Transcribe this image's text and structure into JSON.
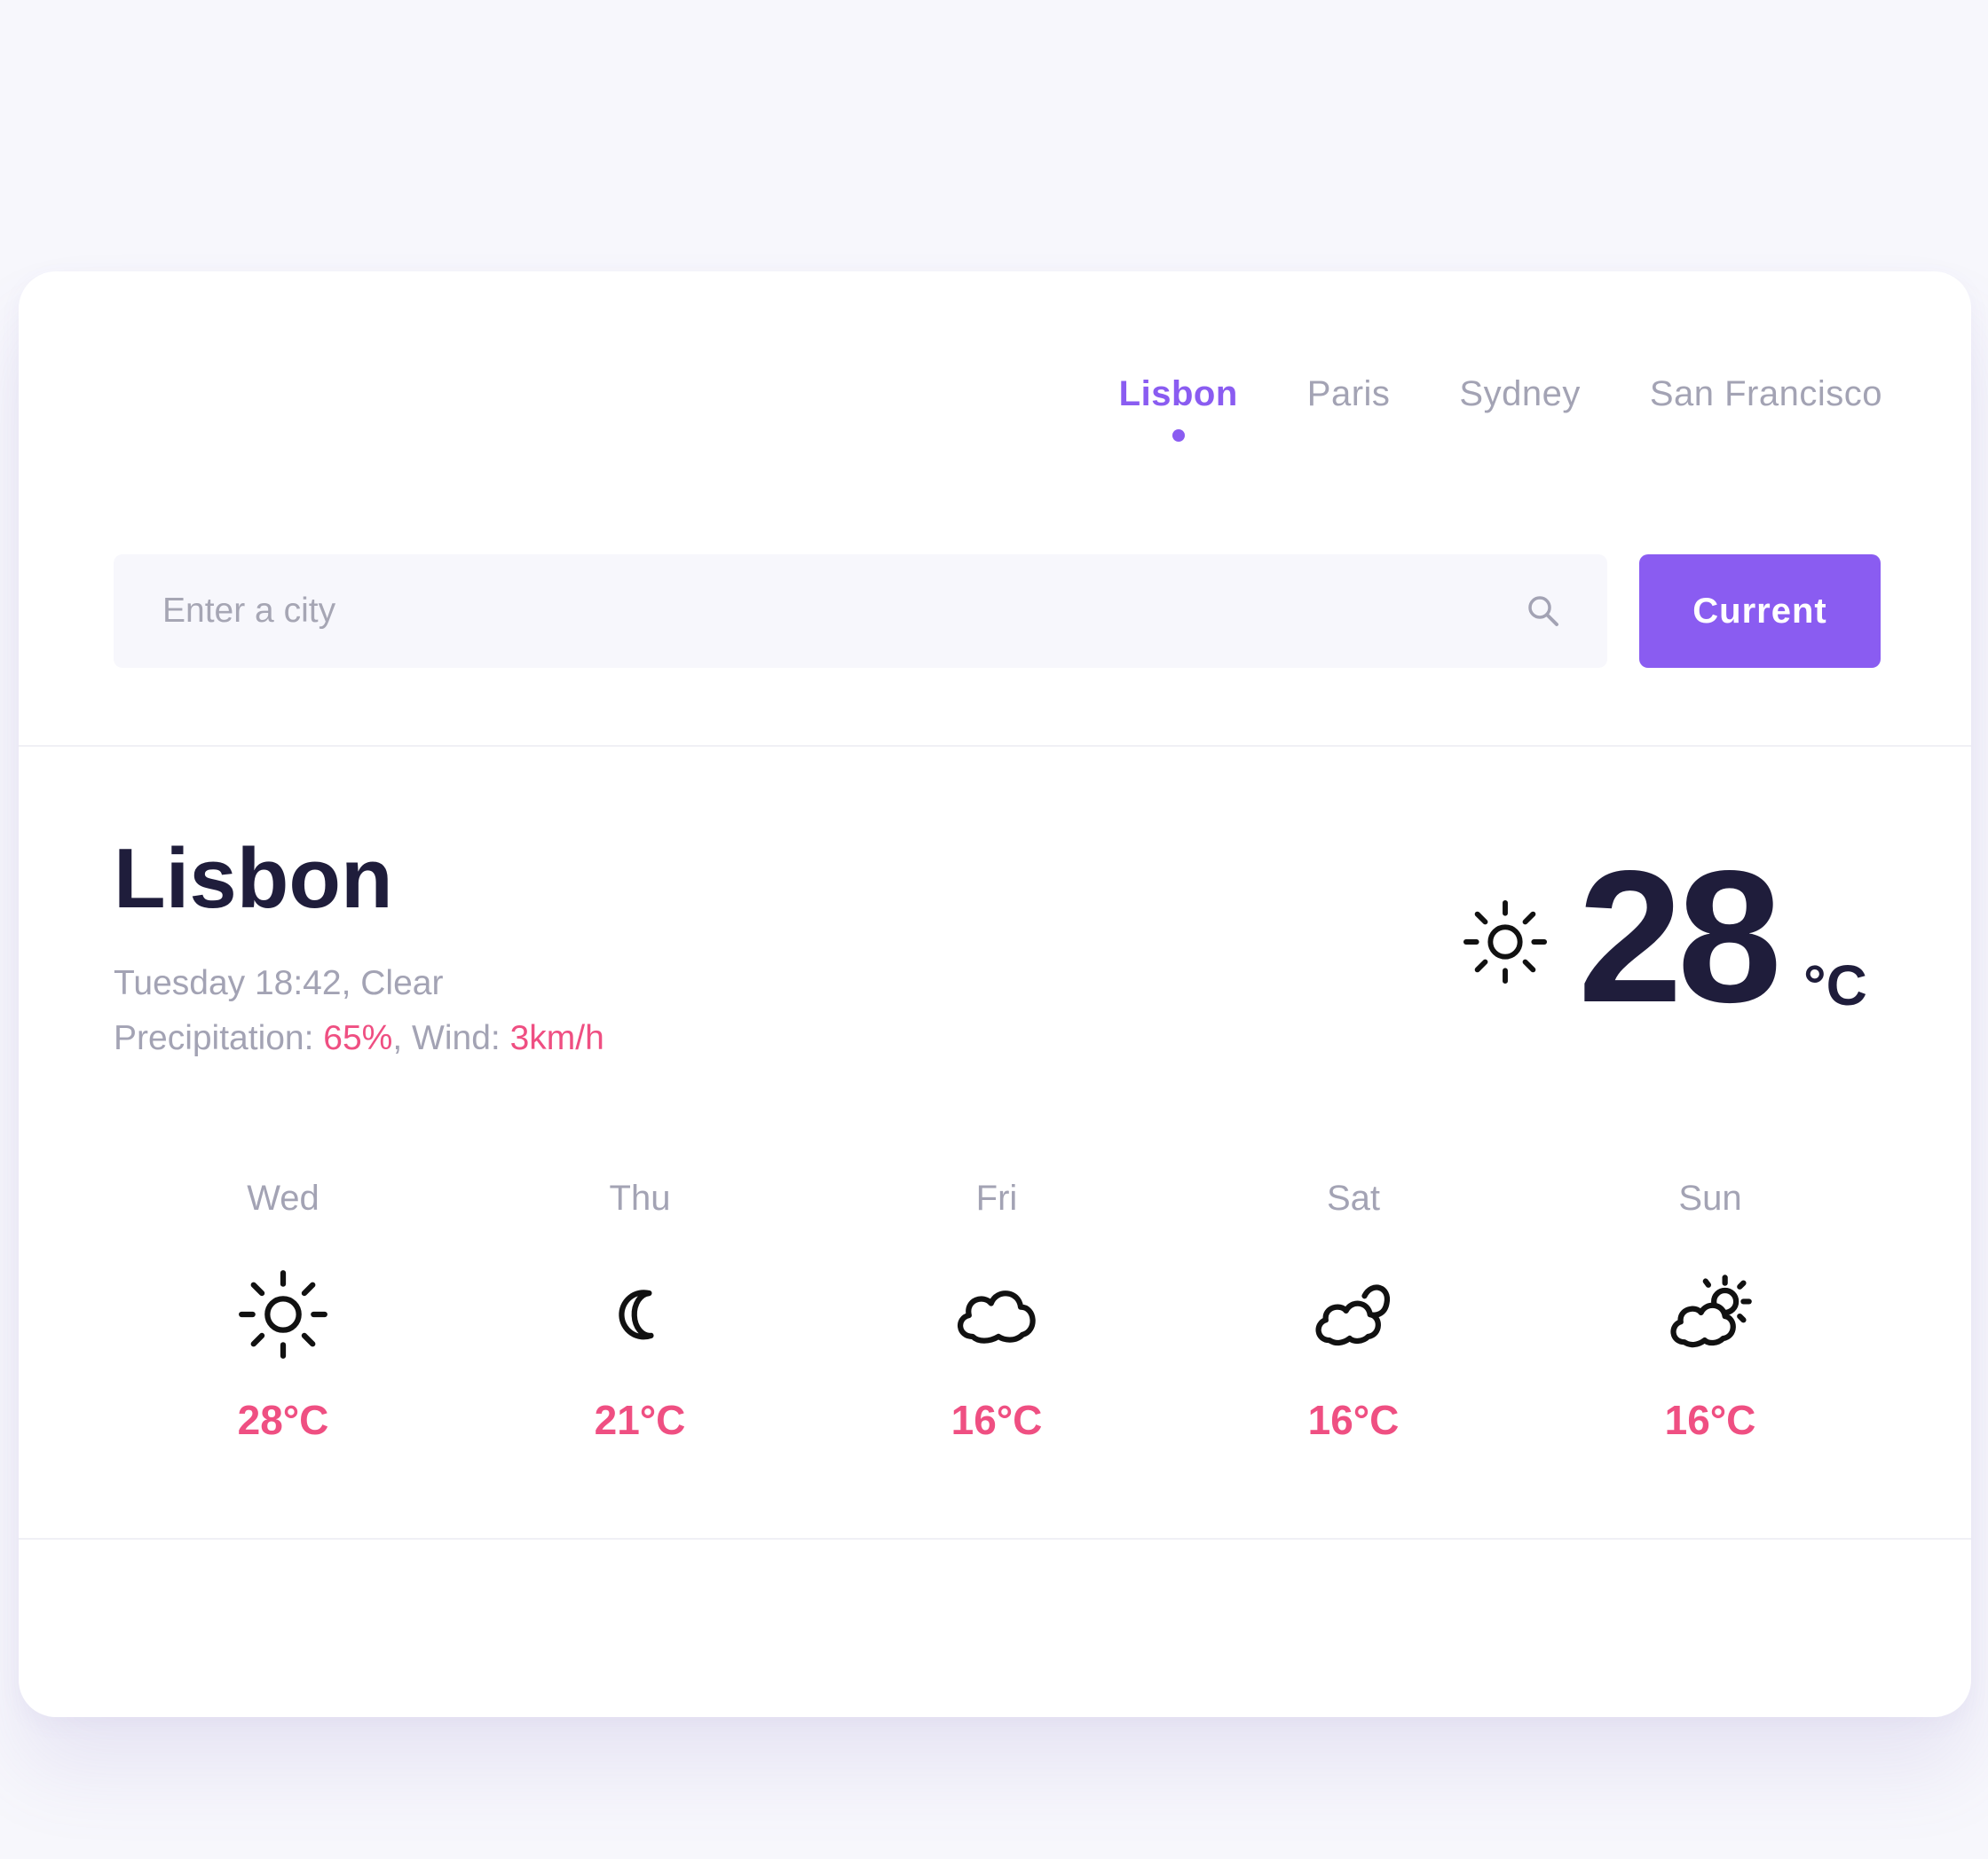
{
  "nav": {
    "items": [
      {
        "label": "Lisbon",
        "active": true
      },
      {
        "label": "Paris",
        "active": false
      },
      {
        "label": "Sydney",
        "active": false
      },
      {
        "label": "San Francisco",
        "active": false
      }
    ]
  },
  "search": {
    "placeholder": "Enter a city",
    "icon": "search-icon",
    "button_label": "Current"
  },
  "current": {
    "city": "Lisbon",
    "datetime_condition": "Tuesday 18:42, Clear",
    "precip_label": "Precipitation: ",
    "precip_value": "65%",
    "wind_label": ", Wind: ",
    "wind_value": "3km/h",
    "icon": "sun-icon",
    "temperature": "28",
    "unit": "°C"
  },
  "forecast": [
    {
      "day": "Wed",
      "icon": "sun-icon",
      "temp": "28°C"
    },
    {
      "day": "Thu",
      "icon": "moon-icon",
      "temp": "21°C"
    },
    {
      "day": "Fri",
      "icon": "cloud-icon",
      "temp": "16°C"
    },
    {
      "day": "Sat",
      "icon": "moon-cloud-icon",
      "temp": "16°C"
    },
    {
      "day": "Sun",
      "icon": "sun-cloud-icon",
      "temp": "16°C"
    }
  ],
  "colors": {
    "accent": "#8a5cf1",
    "highlight": "#ef4f82",
    "text_dark": "#1f1d3b",
    "text_muted": "#a3a3b4"
  }
}
